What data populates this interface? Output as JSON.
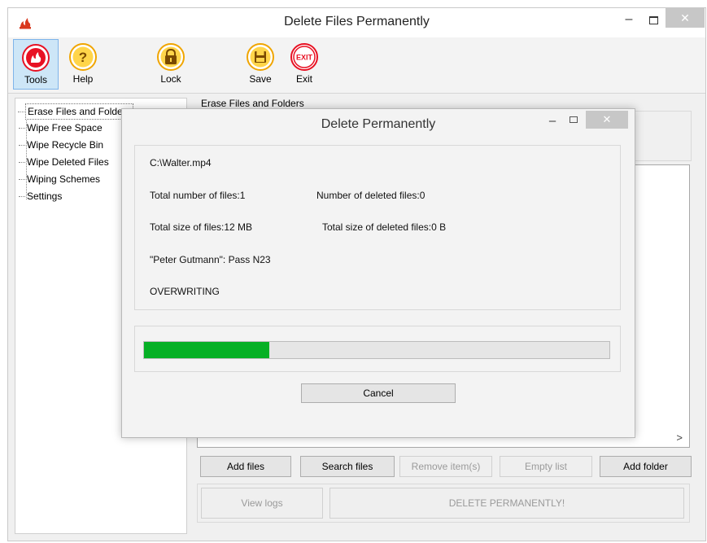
{
  "window": {
    "title": "Delete Files Permanently",
    "close_glyph": "✕",
    "min_glyph": "–"
  },
  "toolbar": {
    "items": [
      {
        "label": "Tools",
        "icon": "tools-icon"
      },
      {
        "label": "Help",
        "icon": "help-icon"
      },
      {
        "label": "Lock",
        "icon": "lock-icon"
      },
      {
        "label": "Save",
        "icon": "save-icon"
      },
      {
        "label": "Exit",
        "icon": "exit-icon",
        "icon_text": "EXIT"
      }
    ]
  },
  "tree": {
    "items": [
      {
        "label": "Erase Files and Folders"
      },
      {
        "label": "Wipe Free Space"
      },
      {
        "label": "Wipe Recycle Bin"
      },
      {
        "label": "Wipe Deleted Files"
      },
      {
        "label": "Wiping Schemes"
      },
      {
        "label": "Settings"
      }
    ]
  },
  "panel": {
    "title": "Erase Files and Folders",
    "buttons": {
      "add_files": "Add files",
      "search_files": "Search files",
      "remove_items": "Remove item(s)",
      "empty_list": "Empty list",
      "add_folder": "Add folder",
      "view_logs": "View logs",
      "delete_permanently": "DELETE PERMANENTLY!"
    },
    "scroll_glyph": ">"
  },
  "dialog": {
    "title": "Delete Permanently",
    "file_path": "C:\\Walter.mp4",
    "total_files": "Total number of files:1",
    "deleted_files": "Number of deleted files:0",
    "total_size": "Total size of files:12 MB",
    "deleted_size": "Total size of deleted files:0 B",
    "scheme_pass": "\"Peter Gutmann\": Pass N23",
    "status": "OVERWRITING",
    "progress_fraction": 0.27,
    "cancel_label": "Cancel",
    "close_glyph": "✕",
    "min_glyph": "–"
  },
  "colors": {
    "progress": "#06b025",
    "selected_tool_bg": "#cde6f7",
    "icon_ring": "#f0a500",
    "exit_red": "#e81123"
  }
}
